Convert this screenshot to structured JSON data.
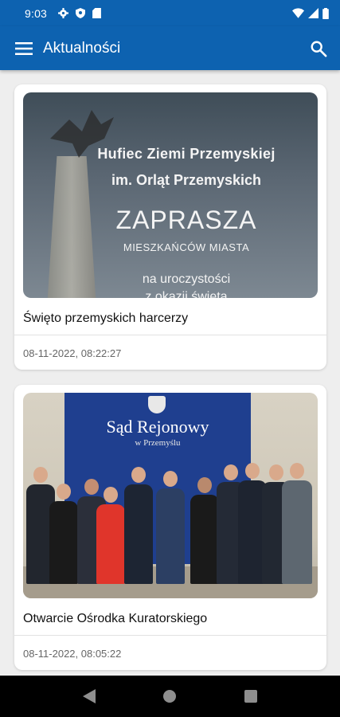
{
  "status_bar": {
    "time": "9:03",
    "left_icons": [
      "settings-icon",
      "shield-icon",
      "sim-card-icon"
    ],
    "right_icons": [
      "wifi-icon",
      "signal-icon",
      "battery-icon"
    ]
  },
  "app_bar": {
    "title": "Aktualności",
    "menu_icon": "menu-icon",
    "search_icon": "search-icon",
    "color": "#0d62b0"
  },
  "feed": {
    "items": [
      {
        "title": "Święto przemyskich harcerzy",
        "date": "08-11-2022, 08:22:27",
        "image": {
          "kind": "poster",
          "lines": [
            "Hufiec Ziemi Przemyskiej",
            "im. Orląt Przemyskich",
            "ZAPRASZA",
            "MIESZKAŃCÓW MIASTA",
            "na uroczystości",
            "z okazji święta"
          ]
        }
      },
      {
        "title": "Otwarcie Ośrodka Kuratorskiego",
        "date": "08-11-2022, 08:05:22",
        "image": {
          "kind": "group-photo",
          "banner_title": "Sąd Rejonowy",
          "banner_subtitle": "w Przemyślu"
        }
      }
    ]
  },
  "nav_bar": {
    "icons": [
      "back-icon",
      "home-icon",
      "recents-icon"
    ]
  }
}
